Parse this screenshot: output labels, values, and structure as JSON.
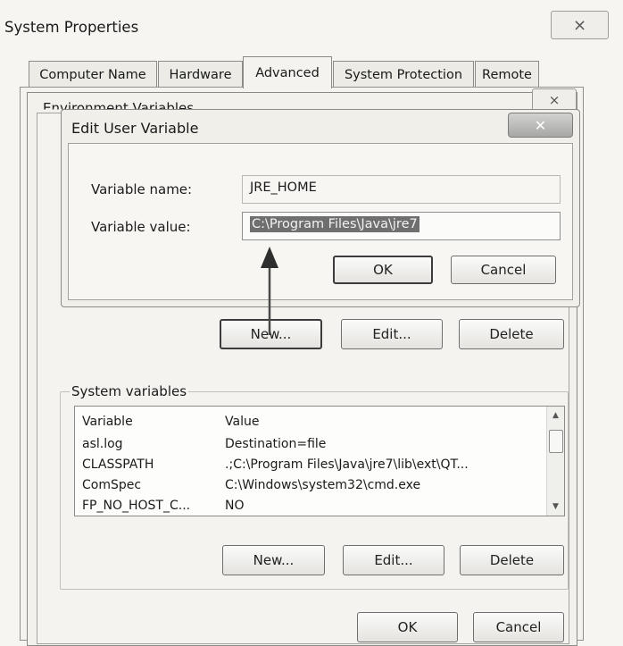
{
  "system_properties": {
    "title": "System Properties",
    "tabs": [
      {
        "label": "Computer Name"
      },
      {
        "label": "Hardware"
      },
      {
        "label": "Advanced"
      },
      {
        "label": "System Protection"
      },
      {
        "label": "Remote"
      }
    ],
    "active_tab": "Advanced"
  },
  "environment_variables": {
    "title": "Environment Variables",
    "user_buttons": {
      "new": "New...",
      "edit": "Edit...",
      "delete": "Delete"
    },
    "system_variables": {
      "heading": "System variables",
      "columns": [
        "Variable",
        "Value"
      ],
      "rows": [
        {
          "variable": "asl.log",
          "value": "Destination=file"
        },
        {
          "variable": "CLASSPATH",
          "value": ".;C:\\Program Files\\Java\\jre7\\lib\\ext\\QT..."
        },
        {
          "variable": "ComSpec",
          "value": "C:\\Windows\\system32\\cmd.exe"
        },
        {
          "variable": "FP_NO_HOST_C...",
          "value": "NO"
        }
      ],
      "buttons": {
        "new": "New...",
        "edit": "Edit...",
        "delete": "Delete"
      }
    },
    "footer_buttons": {
      "ok": "OK",
      "cancel": "Cancel"
    }
  },
  "edit_user_variable": {
    "title": "Edit User Variable",
    "variable_name_label": "Variable name:",
    "variable_name_value": "JRE_HOME",
    "variable_value_label": "Variable value:",
    "variable_value_value": "C:\\Program Files\\Java\\jre7",
    "ok": "OK",
    "cancel": "Cancel"
  },
  "colors": {
    "selection": "#6f6f6f",
    "close_button": "#b8b8b6",
    "window_frame": "#9a9a96"
  }
}
